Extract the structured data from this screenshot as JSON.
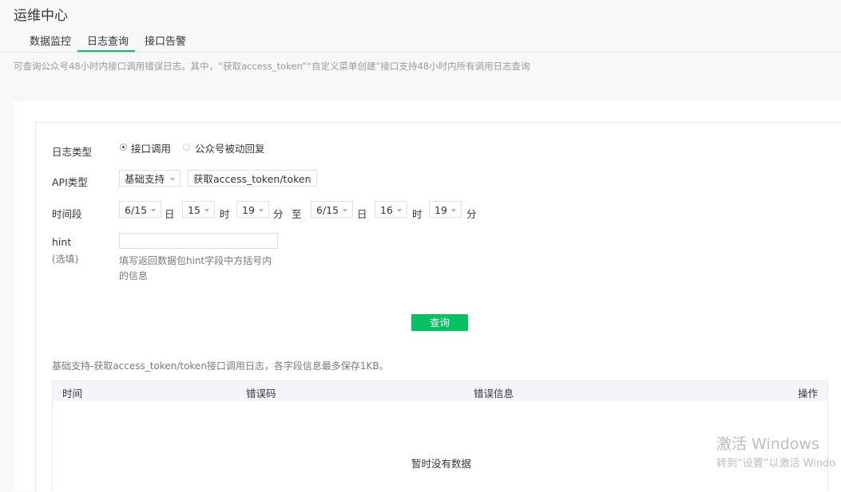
{
  "header": {
    "title": "运维中心"
  },
  "tabs": [
    {
      "label": "数据监控"
    },
    {
      "label": "日志查询",
      "active": true
    },
    {
      "label": "接口告警"
    }
  ],
  "notice": "可查询公众号48小时内接口调用错误日志。其中，“获取access_token”“自定义菜单创建”接口支持48小时内所有调用日志查询",
  "form": {
    "log_type": {
      "label": "日志类型",
      "options": [
        "接口调用",
        "公众号被动回复"
      ],
      "selected": "接口调用"
    },
    "api_type": {
      "label": "API类型",
      "category": "基础支持",
      "api": "获取access_token/token"
    },
    "time_range": {
      "label": "时间段",
      "start": {
        "date": "6/15",
        "hour": "15",
        "minute": "19"
      },
      "end": {
        "date": "6/15",
        "hour": "16",
        "minute": "19"
      },
      "unit_day": "日",
      "unit_hour": "时",
      "unit_minute": "分",
      "separator": "至"
    },
    "hint": {
      "label": "hint",
      "optional": "(选填)",
      "value": "",
      "help_line1": "填写返回数据包hint字段中方括号内",
      "help_line2": "的信息"
    },
    "query_button": "查询"
  },
  "table": {
    "description": "基础支持-获取access_token/token接口调用日志，各字段信息最多保存1KB。",
    "columns": [
      "时间",
      "错误码",
      "错误信息",
      "操作"
    ],
    "rows": [],
    "empty_text": "暂时没有数据"
  },
  "watermark": {
    "line1": "激活 Windows",
    "line2": "转到“设置”以激活 Windo"
  }
}
